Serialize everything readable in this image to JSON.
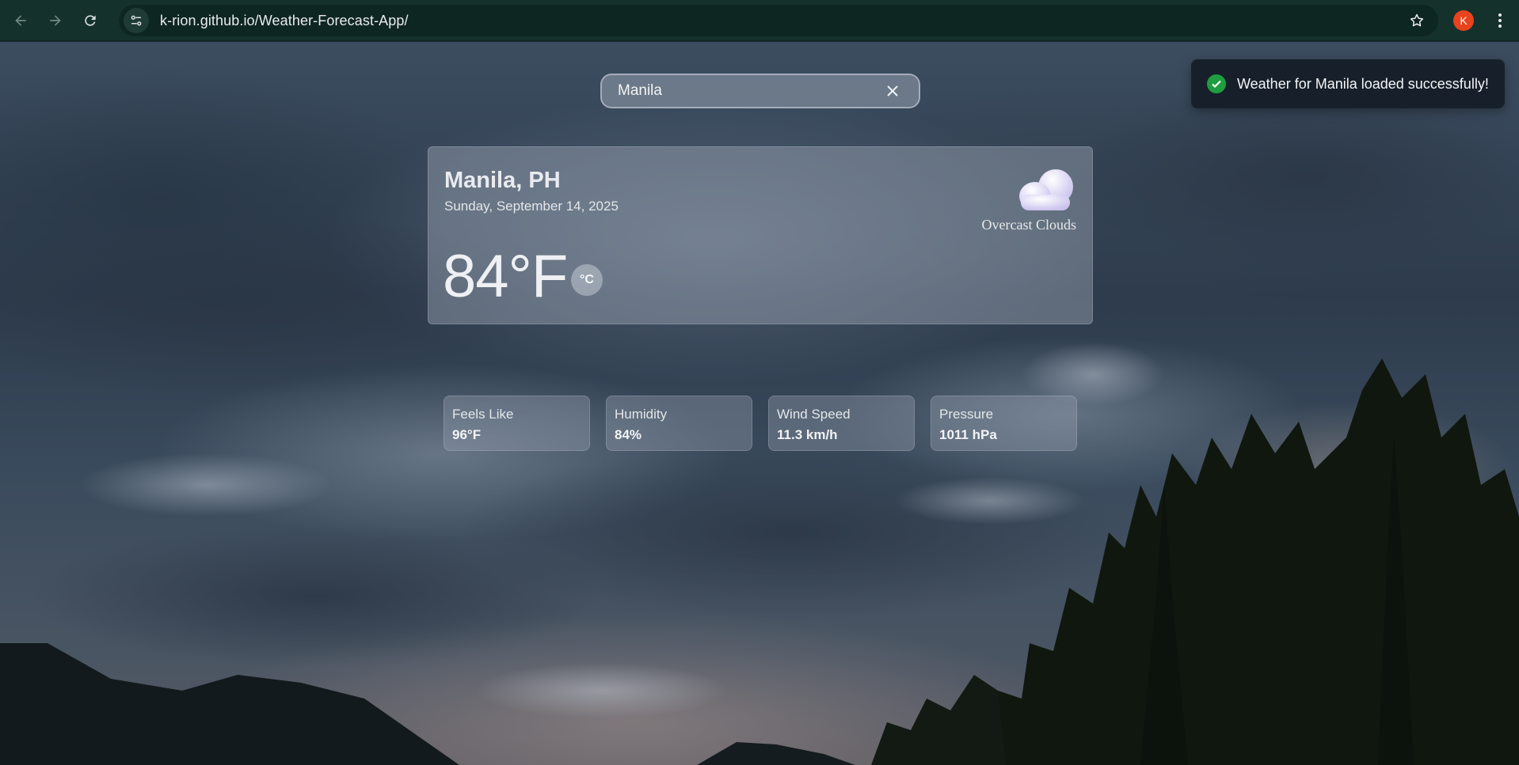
{
  "browser": {
    "url": "k-rion.github.io/Weather-Forecast-App/",
    "profile_initial": "K",
    "back_icon": "arrow-left-icon",
    "forward_icon": "arrow-right-icon",
    "reload_icon": "reload-icon",
    "bookmark_icon": "star-icon",
    "menu_icon": "kebab-menu-icon"
  },
  "search": {
    "value": "Manila",
    "clear_icon": "close-icon"
  },
  "toast": {
    "message": "Weather for Manila loaded successfully!",
    "icon": "check-circle-icon",
    "status_color": "#1e9e40"
  },
  "weather": {
    "location": "Manila, PH",
    "date": "Sunday, September 14, 2025",
    "temperature": "84°F",
    "unit_toggle_label": "°C",
    "condition": "Overcast Clouds",
    "condition_icon": "cloud-icon"
  },
  "stats": [
    {
      "label": "Feels Like",
      "value": "96°F"
    },
    {
      "label": "Humidity",
      "value": "84%"
    },
    {
      "label": "Wind Speed",
      "value": "11.3 km/h"
    },
    {
      "label": "Pressure",
      "value": "1011 hPa"
    }
  ],
  "colors": {
    "chrome_bg": "#14312c",
    "avatar_bg": "#e8431d",
    "toast_bg": "#17202a"
  }
}
